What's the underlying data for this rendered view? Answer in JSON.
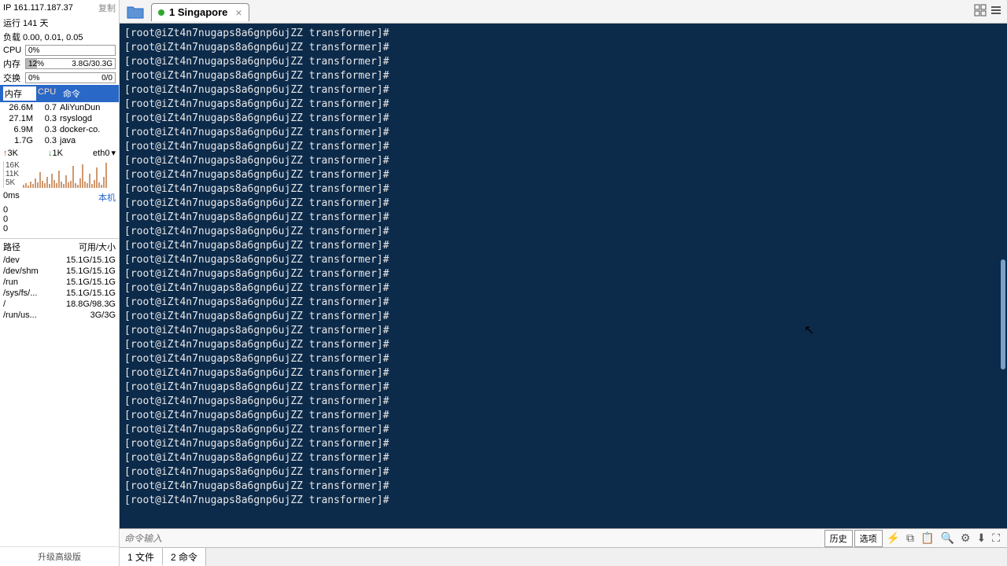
{
  "ip": "IP 161.117.187.37",
  "copy_label": "复制",
  "uptime": "运行 141 天",
  "load": "负载 0.00, 0.01, 0.05",
  "meters": {
    "cpu": {
      "label": "CPU",
      "pct": "0%",
      "fill": 0
    },
    "mem": {
      "label": "内存",
      "pct": "12%",
      "detail": "3.8G/30.3G",
      "fill": 12
    },
    "swp": {
      "label": "交换",
      "pct": "0%",
      "detail": "0/0",
      "fill": 0
    }
  },
  "proc_header": {
    "mem": "内存",
    "cpu": "CPU",
    "cmd": "命令"
  },
  "procs": [
    {
      "mem": "26.6M",
      "cpu": "0.7",
      "cmd": "AliYunDun"
    },
    {
      "mem": "27.1M",
      "cpu": "0.3",
      "cmd": "rsyslogd"
    },
    {
      "mem": "6.9M",
      "cpu": "0.3",
      "cmd": "docker-co."
    },
    {
      "mem": "1.7G",
      "cpu": "0.3",
      "cmd": "java"
    }
  ],
  "net": {
    "up": "3K",
    "down": "1K",
    "iface": "eth0",
    "scale": [
      "16K",
      "11K",
      "5K"
    ]
  },
  "ping": {
    "head": "0ms",
    "local": "本机",
    "vals": [
      "0",
      "0",
      "0"
    ]
  },
  "disk_header": {
    "path": "路径",
    "size": "可用/大小"
  },
  "disks": [
    {
      "path": "/dev",
      "size": "15.1G/15.1G"
    },
    {
      "path": "/dev/shm",
      "size": "15.1G/15.1G"
    },
    {
      "path": "/run",
      "size": "15.1G/15.1G"
    },
    {
      "path": "/sys/fs/...",
      "size": "15.1G/15.1G"
    },
    {
      "path": "/",
      "size": "18.8G/98.3G"
    },
    {
      "path": "/run/us...",
      "size": "3G/3G"
    }
  ],
  "upgrade": "升级高级版",
  "tab": {
    "title": "1 Singapore"
  },
  "terminal_prompt": "[root@iZt4n7nugaps8a6gnp6ujZZ transformer]#",
  "terminal_line_count": 34,
  "cmd_placeholder": "命令输入",
  "btns": {
    "history": "历史",
    "options": "选项"
  },
  "bottom_tabs": [
    {
      "label": "1 文件"
    },
    {
      "label": "2 命令"
    }
  ]
}
